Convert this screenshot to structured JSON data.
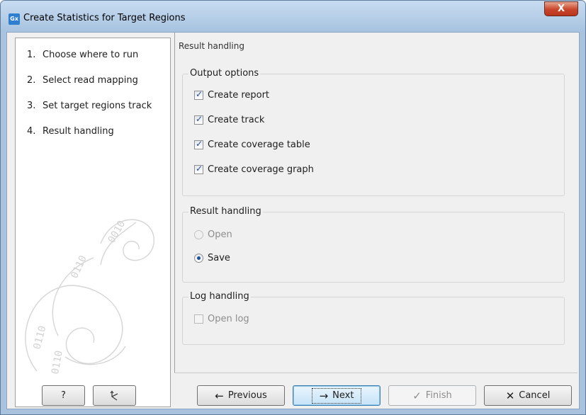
{
  "window": {
    "app_icon": "Gx",
    "title": "Create Statistics for Target Regions",
    "close_label": "X"
  },
  "steps": [
    {
      "num": "1.",
      "label": "Choose where to run"
    },
    {
      "num": "2.",
      "label": "Select read mapping"
    },
    {
      "num": "3.",
      "label": "Set target regions track"
    },
    {
      "num": "4.",
      "label": "Result handling"
    }
  ],
  "page": {
    "heading": "Result handling"
  },
  "output_options": {
    "title": "Output options",
    "items": [
      {
        "label": "Create report",
        "checked": true
      },
      {
        "label": "Create track",
        "checked": true
      },
      {
        "label": "Create coverage table",
        "checked": true
      },
      {
        "label": "Create coverage graph",
        "checked": true
      }
    ]
  },
  "result_handling": {
    "title": "Result handling",
    "items": [
      {
        "label": "Open",
        "selected": false,
        "enabled": false
      },
      {
        "label": "Save",
        "selected": true,
        "enabled": true
      }
    ]
  },
  "log_handling": {
    "title": "Log handling",
    "open_log_label": "Open log",
    "checked": false,
    "enabled": false
  },
  "buttons": {
    "help": "?",
    "reset_icon": "undo-arrow-icon",
    "previous": "Previous",
    "next": "Next",
    "finish": "Finish",
    "cancel": "Cancel"
  },
  "colors": {
    "title_bar": "#a7c3e0",
    "close_button": "#c8452b",
    "focused_button": "#c6e3f7"
  }
}
